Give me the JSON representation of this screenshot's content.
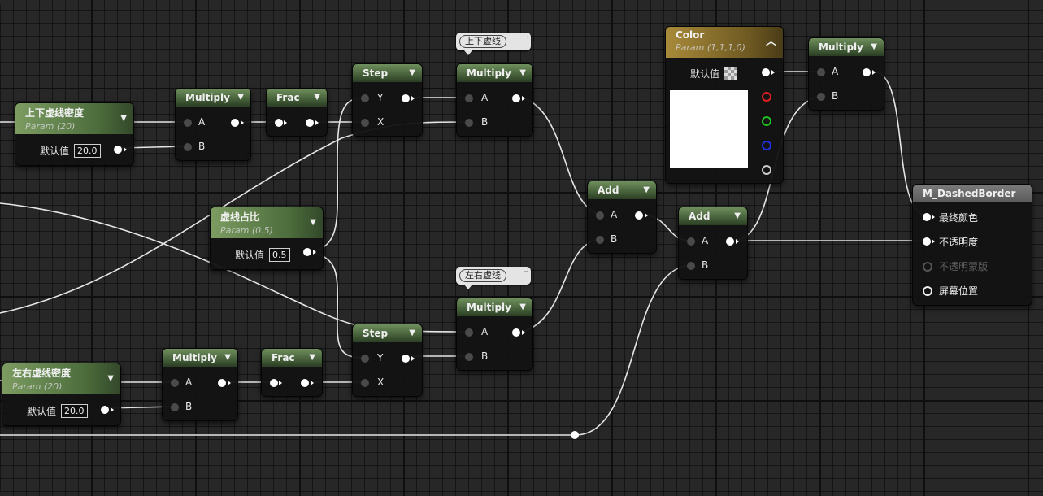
{
  "nodes": {
    "param_ud": {
      "title": "上下虚线密度",
      "sub": "Param (20)",
      "default_label": "默认值",
      "value": "20.0"
    },
    "param_lr": {
      "title": "左右虚线密度",
      "sub": "Param (20)",
      "default_label": "默认值",
      "value": "20.0"
    },
    "param_ratio": {
      "title": "虚线占比",
      "sub": "Param (0.5)",
      "default_label": "默认值",
      "value": "0.5"
    },
    "mul_top": {
      "title": "Multiply",
      "pin_a": "A",
      "pin_b": "B"
    },
    "mul_bottom": {
      "title": "Multiply",
      "pin_a": "A",
      "pin_b": "B"
    },
    "frac_top": {
      "title": "Frac"
    },
    "frac_bottom": {
      "title": "Frac"
    },
    "step_top": {
      "title": "Step",
      "pin_y": "Y",
      "pin_x": "X"
    },
    "step_bottom": {
      "title": "Step",
      "pin_y": "Y",
      "pin_x": "X"
    },
    "mul_ud": {
      "title": "Multiply",
      "pin_a": "A",
      "pin_b": "B",
      "comment": "上下虚线"
    },
    "mul_lr": {
      "title": "Multiply",
      "pin_a": "A",
      "pin_b": "B",
      "comment": "左右虚线"
    },
    "add_1": {
      "title": "Add",
      "pin_a": "A",
      "pin_b": "B"
    },
    "add_2": {
      "title": "Add",
      "pin_a": "A",
      "pin_b": "B"
    },
    "color": {
      "title": "Color",
      "sub": "Param (1,1,1,0)",
      "default_label": "默认值",
      "swatch_color": "#ffffff"
    },
    "mul_color": {
      "title": "Multiply",
      "pin_a": "A",
      "pin_b": "B"
    },
    "result": {
      "title": "M_DashedBorder",
      "pins": [
        "最终颜色",
        "不透明度",
        "不透明蒙版",
        "屏幕位置"
      ]
    }
  },
  "colors": {
    "param_header": "#4c6d3c",
    "color_header": "#6f5a22",
    "wire": "#e6e6e6",
    "pin_r": "#e02020",
    "pin_g": "#20c020",
    "pin_b": "#2030e0"
  }
}
